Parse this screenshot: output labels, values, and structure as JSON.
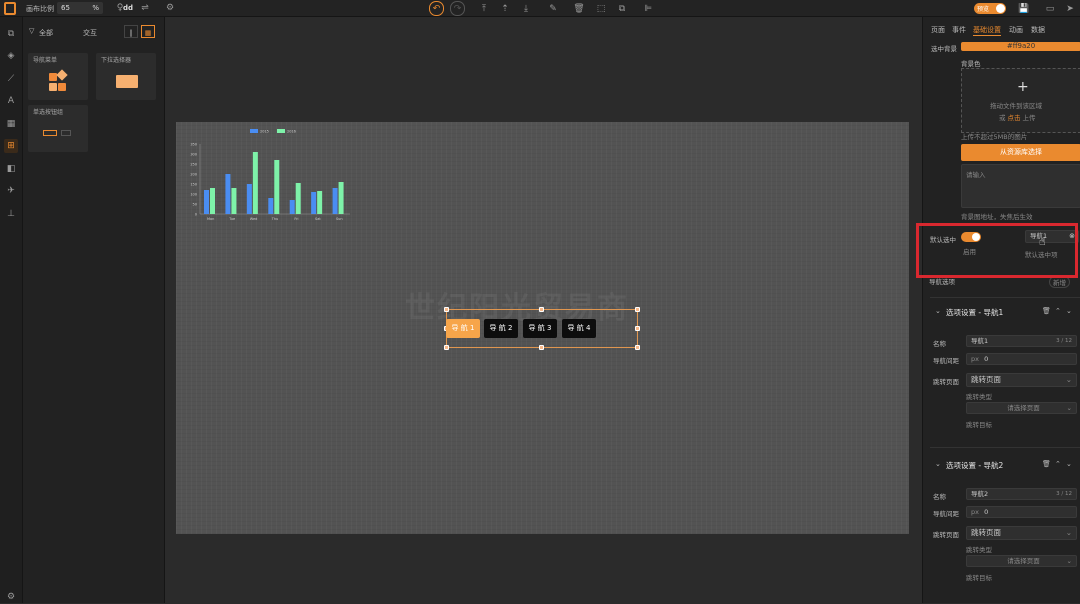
{
  "topbar": {
    "zoom_label": "画布比例",
    "zoom_value": "65",
    "zoom_unit": "%",
    "font_label": "dd",
    "preview_toggle_label": "预览"
  },
  "left_panel": {
    "filter_all": "全部",
    "tab_interact": "交互",
    "components": [
      {
        "label": "导航菜单"
      },
      {
        "label": "下拉选择器"
      },
      {
        "label": "单选按钮组"
      }
    ]
  },
  "chart_data": {
    "type": "bar",
    "categories": [
      "Mon",
      "Tue",
      "Wed",
      "Thu",
      "Fri",
      "Sat",
      "Sun"
    ],
    "series": [
      {
        "name": "2015",
        "values": [
          120,
          200,
          150,
          80,
          70,
          110,
          130
        ]
      },
      {
        "name": "2016",
        "values": [
          130,
          130,
          310,
          270,
          155,
          115,
          160
        ]
      }
    ],
    "ylim": [
      0,
      350
    ],
    "yticks": [
      "350",
      "300",
      "250",
      "200",
      "150",
      "100",
      "50",
      "0"
    ],
    "colors": [
      "#4a8df2",
      "#7ef2a9"
    ]
  },
  "canvas": {
    "watermark": "世纪阳光贸易商",
    "nav_items": [
      "导 航 1",
      "导 航 2",
      "导 航 3",
      "导 航 4"
    ],
    "active_color": "#f7a54a"
  },
  "right_panel": {
    "tabs": [
      "页面",
      "事件",
      "基础设置",
      "动画",
      "数据"
    ],
    "selected_bg_label": "选中背景",
    "selected_bg_value": "#ff9a20",
    "bg_label": "背景色",
    "upload_hint": "拖动文件到该区域",
    "upload_or": "或",
    "upload_click": "点击",
    "upload_action": "上传",
    "upload_limit": "上传不超过5MB的图片",
    "select_from_library": "从资源库选择",
    "url_placeholder": "请输入",
    "url_hint": "背景图地址，失焦后生效",
    "default_selected_label": "默认选中",
    "enabled_label": "启用",
    "default_item_value": "导航1",
    "default_item_hint": "默认选中项",
    "nav_options_label": "导航选项",
    "add_label": "新增",
    "options": [
      {
        "title": "选项设置 - 导航1",
        "name_label": "名称",
        "name_value": "导航1",
        "count": "3 / 12",
        "gap_label": "导航间距",
        "gap_unit": "px",
        "gap_value": "0",
        "jump_label": "跳转页面",
        "jump_value": "跳转页面",
        "jump_type_label": "跳转类型",
        "jump_placeholder": "请选择页面",
        "target_label": "跳转目标"
      },
      {
        "title": "选项设置 - 导航2",
        "name_label": "名称",
        "name_value": "导航2",
        "count": "3 / 12",
        "gap_label": "导航间距",
        "gap_unit": "px",
        "gap_value": "0",
        "jump_label": "跳转页面",
        "jump_value": "跳转页面",
        "jump_type_label": "跳转类型",
        "jump_placeholder": "请选择页面",
        "target_label": "跳转目标"
      }
    ]
  }
}
